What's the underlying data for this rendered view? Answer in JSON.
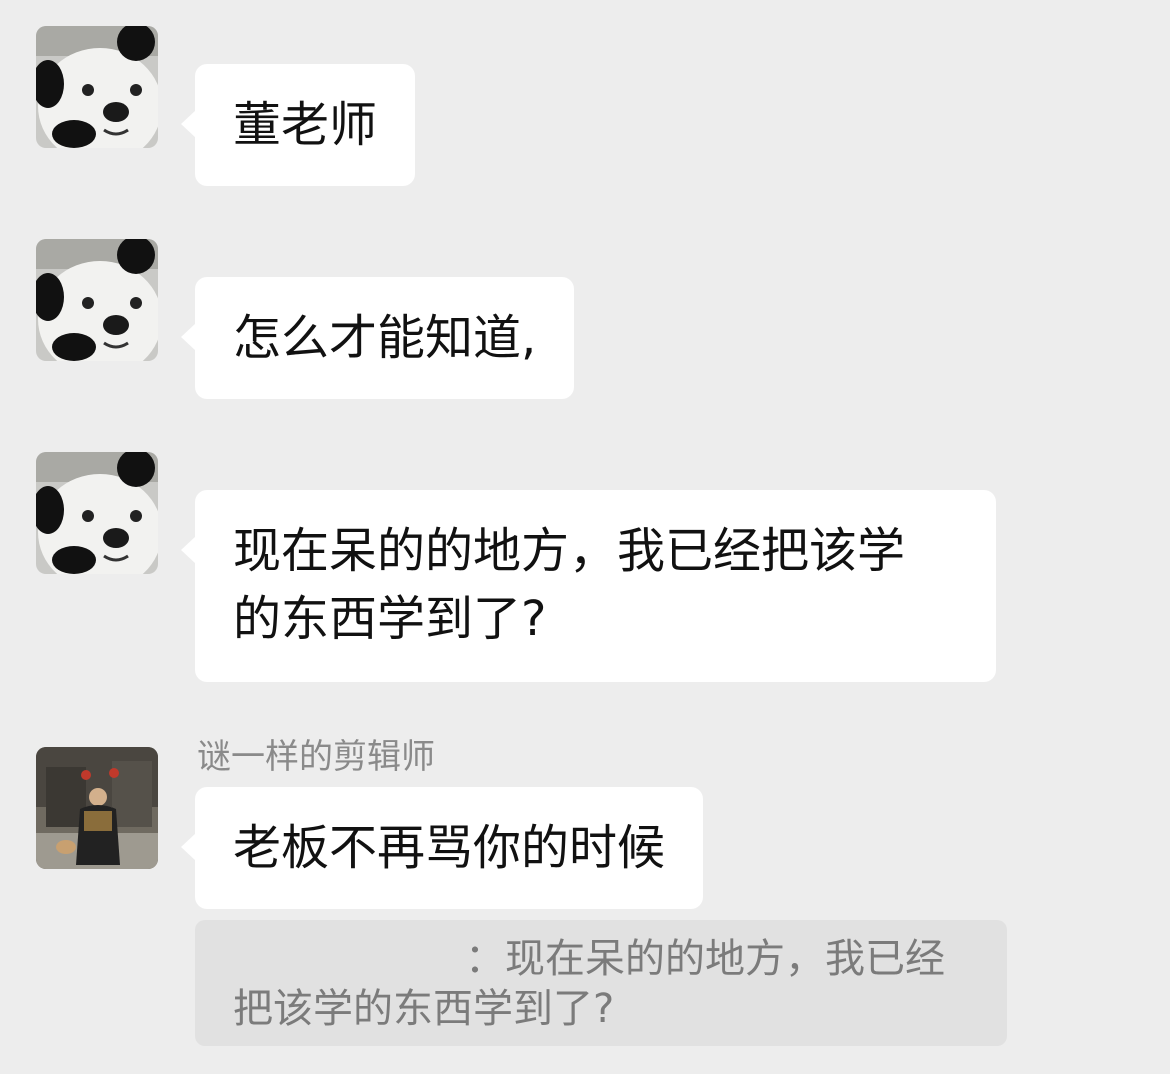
{
  "messages": [
    {
      "sender": "",
      "text": "董老师",
      "avatar": "panda-dog-avatar"
    },
    {
      "sender": "",
      "text": "怎么才能知道,",
      "avatar": "panda-dog-avatar"
    },
    {
      "sender": "",
      "lines": [
        "现在呆的的地方，我已经把该学",
        "的东西学到了?"
      ],
      "avatar": "panda-dog-avatar"
    },
    {
      "sender": "谜一样的剪辑师",
      "text": "老板不再骂你的时候",
      "avatar": "person-photo-avatar"
    }
  ],
  "quote": {
    "line1": "：现在呆的的地方，我已经",
    "line2": "把该学的东西学到了?"
  }
}
